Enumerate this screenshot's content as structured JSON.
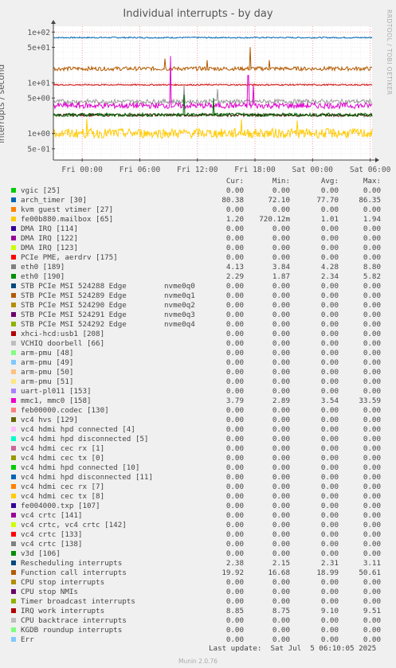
{
  "title": "Individual interrupts - by day",
  "watermark": "RRDTOOL / TOBI OETIKER",
  "munin_version": "Munin 2.0.76",
  "last_update": "Last update:  Sat Jul  5 06:10:05 2025",
  "columns": {
    "cur": "Cur:",
    "min": "Min:",
    "avg": "Avg:",
    "max": "Max:"
  },
  "chart_data": {
    "type": "line",
    "ylabel": "interrupts / second",
    "yscale": "log",
    "ylim": [
      0.3,
      130
    ],
    "y_ticks": [
      "1e+02",
      "5e+01",
      "1e+01",
      "5e+00",
      "1e+00",
      "5e-01"
    ],
    "y_tick_values": [
      100,
      50,
      10,
      5,
      1,
      0.5
    ],
    "x_ticks": [
      "Fri 00:00",
      "Fri 06:00",
      "Fri 12:00",
      "Fri 18:00",
      "Sat 00:00",
      "Sat 06:00"
    ],
    "x_tick_hours": [
      0,
      6,
      12,
      18,
      24,
      30
    ],
    "xlim_hours": [
      -3.0,
      30.2
    ],
    "grid": true,
    "series": [
      {
        "name": "arch_timer [30]",
        "color": "#0066B3",
        "base": 77.7,
        "noise": 0.03,
        "spikes": []
      },
      {
        "name": "Function call interrupts",
        "color": "#B35A00",
        "base": 19.0,
        "noise": 0.09,
        "spikes": [
          [
            8.6,
            30
          ],
          [
            13.0,
            28
          ],
          [
            17.5,
            50.6
          ],
          [
            19.5,
            28
          ]
        ]
      },
      {
        "name": "Rescheduling interrupts",
        "color": "#440000",
        "base": 2.31,
        "noise": 0.06,
        "spikes": []
      },
      {
        "name": "IRQ work interrupts",
        "color": "#CC0000",
        "base": 9.1,
        "noise": 0.03,
        "spikes": []
      },
      {
        "name": "eth0 [189]",
        "color": "#999999",
        "base": 4.28,
        "noise": 0.1,
        "spikes": [
          [
            10.6,
            8.8
          ],
          [
            14.1,
            7.5
          ]
        ]
      },
      {
        "name": "mmc1, mmc0 [158]",
        "color": "#DD00CC",
        "base": 3.54,
        "noise": 0.13,
        "spikes": [
          [
            9.2,
            33.59
          ],
          [
            17.3,
            14.0
          ],
          [
            17.8,
            9.0
          ]
        ]
      },
      {
        "name": "eth0 [190]",
        "color": "#006600",
        "base": 2.34,
        "noise": 0.08,
        "spikes": [
          [
            10.6,
            5.82
          ],
          [
            13.7,
            5.0
          ]
        ]
      },
      {
        "name": "fe00b880.mailbox [65]",
        "color": "#FFCC00",
        "base": 1.01,
        "noise": 0.22,
        "spikes": [
          [
            0.5,
            1.94
          ],
          [
            16.6,
            1.9
          ],
          [
            22.4,
            1.8
          ]
        ]
      }
    ],
    "legend": [
      {
        "name": "vgic [25]",
        "color": "#00CC00",
        "cur": "0.00",
        "min": "0.00",
        "avg": "0.00",
        "max": "0.00"
      },
      {
        "name": "arch_timer [30]",
        "color": "#0066B3",
        "cur": "80.38",
        "min": "72.10",
        "avg": "77.70",
        "max": "86.35"
      },
      {
        "name": "kvm guest vtimer [27]",
        "color": "#FF8000",
        "cur": "0.00",
        "min": "0.00",
        "avg": "0.00",
        "max": "0.00"
      },
      {
        "name": "fe00b880.mailbox [65]",
        "color": "#FFCC00",
        "cur": "1.20",
        "min": "720.12m",
        "avg": "1.01",
        "max": "1.94"
      },
      {
        "name": "DMA IRQ [114]",
        "color": "#330099",
        "cur": "0.00",
        "min": "0.00",
        "avg": "0.00",
        "max": "0.00"
      },
      {
        "name": "DMA IRQ [122]",
        "color": "#990099",
        "cur": "0.00",
        "min": "0.00",
        "avg": "0.00",
        "max": "0.00"
      },
      {
        "name": "DMA IRQ [123]",
        "color": "#CCFF00",
        "cur": "0.00",
        "min": "0.00",
        "avg": "0.00",
        "max": "0.00"
      },
      {
        "name": "PCIe PME, aerdrv [175]",
        "color": "#FF0000",
        "cur": "0.00",
        "min": "0.00",
        "avg": "0.00",
        "max": "0.00"
      },
      {
        "name": "eth0 [189]",
        "color": "#808080",
        "cur": "4.13",
        "min": "3.84",
        "avg": "4.28",
        "max": "8.80"
      },
      {
        "name": "eth0 [190]",
        "color": "#008F00",
        "cur": "2.29",
        "min": "1.87",
        "avg": "2.34",
        "max": "5.82"
      },
      {
        "name": "STB PCIe MSI 524288 Edge",
        "dev": "nvme0q0",
        "color": "#00487D",
        "cur": "0.00",
        "min": "0.00",
        "avg": "0.00",
        "max": "0.00"
      },
      {
        "name": "STB PCIe MSI 524289 Edge",
        "dev": "nvme0q1",
        "color": "#B35A00",
        "cur": "0.00",
        "min": "0.00",
        "avg": "0.00",
        "max": "0.00"
      },
      {
        "name": "STB PCIe MSI 524290 Edge",
        "dev": "nvme0q2",
        "color": "#B38F00",
        "cur": "0.00",
        "min": "0.00",
        "avg": "0.00",
        "max": "0.00"
      },
      {
        "name": "STB PCIe MSI 524291 Edge",
        "dev": "nvme0q3",
        "color": "#6B006B",
        "cur": "0.00",
        "min": "0.00",
        "avg": "0.00",
        "max": "0.00"
      },
      {
        "name": "STB PCIe MSI 524292 Edge",
        "dev": "nvme0q4",
        "color": "#8FB300",
        "cur": "0.00",
        "min": "0.00",
        "avg": "0.00",
        "max": "0.00"
      },
      {
        "name": "xhci-hcd:usb1 [208]",
        "color": "#B30000",
        "cur": "0.00",
        "min": "0.00",
        "avg": "0.00",
        "max": "0.00"
      },
      {
        "name": "VCHIQ doorbell [66]",
        "color": "#BEBEBE",
        "cur": "0.00",
        "min": "0.00",
        "avg": "0.00",
        "max": "0.00"
      },
      {
        "name": "arm-pmu [48]",
        "color": "#80FF80",
        "cur": "0.00",
        "min": "0.00",
        "avg": "0.00",
        "max": "0.00"
      },
      {
        "name": "arm-pmu [49]",
        "color": "#80C9FF",
        "cur": "0.00",
        "min": "0.00",
        "avg": "0.00",
        "max": "0.00"
      },
      {
        "name": "arm-pmu [50]",
        "color": "#FFC080",
        "cur": "0.00",
        "min": "0.00",
        "avg": "0.00",
        "max": "0.00"
      },
      {
        "name": "arm-pmu [51]",
        "color": "#FFE680",
        "cur": "0.00",
        "min": "0.00",
        "avg": "0.00",
        "max": "0.00"
      },
      {
        "name": "uart-pl011 [153]",
        "color": "#AA80FF",
        "cur": "0.00",
        "min": "0.00",
        "avg": "0.00",
        "max": "0.00"
      },
      {
        "name": "mmc1, mmc0 [158]",
        "color": "#EE00CC",
        "cur": "3.79",
        "min": "2.89",
        "avg": "3.54",
        "max": "33.59"
      },
      {
        "name": "feb00000.codec [130]",
        "color": "#FF8080",
        "cur": "0.00",
        "min": "0.00",
        "avg": "0.00",
        "max": "0.00"
      },
      {
        "name": "vc4 hvs [129]",
        "color": "#666600",
        "cur": "0.00",
        "min": "0.00",
        "avg": "0.00",
        "max": "0.00"
      },
      {
        "name": "vc4 hdmi hpd connected [4]",
        "color": "#FFBFFF",
        "cur": "0.00",
        "min": "0.00",
        "avg": "0.00",
        "max": "0.00"
      },
      {
        "name": "vc4 hdmi hpd disconnected [5]",
        "color": "#00FFCC",
        "cur": "0.00",
        "min": "0.00",
        "avg": "0.00",
        "max": "0.00"
      },
      {
        "name": "vc4 hdmi cec rx [1]",
        "color": "#CC6699",
        "cur": "0.00",
        "min": "0.00",
        "avg": "0.00",
        "max": "0.00"
      },
      {
        "name": "vc4 hdmi cec tx [0]",
        "color": "#999900",
        "cur": "0.00",
        "min": "0.00",
        "avg": "0.00",
        "max": "0.00"
      },
      {
        "name": "vc4 hdmi hpd connected [10]",
        "color": "#00CC00",
        "cur": "0.00",
        "min": "0.00",
        "avg": "0.00",
        "max": "0.00"
      },
      {
        "name": "vc4 hdmi hpd disconnected [11]",
        "color": "#0066B3",
        "cur": "0.00",
        "min": "0.00",
        "avg": "0.00",
        "max": "0.00"
      },
      {
        "name": "vc4 hdmi cec rx [7]",
        "color": "#FF8000",
        "cur": "0.00",
        "min": "0.00",
        "avg": "0.00",
        "max": "0.00"
      },
      {
        "name": "vc4 hdmi cec tx [8]",
        "color": "#FFCC00",
        "cur": "0.00",
        "min": "0.00",
        "avg": "0.00",
        "max": "0.00"
      },
      {
        "name": "fe004000.txp [107]",
        "color": "#330099",
        "cur": "0.00",
        "min": "0.00",
        "avg": "0.00",
        "max": "0.00"
      },
      {
        "name": "vc4 crtc [141]",
        "color": "#990099",
        "cur": "0.00",
        "min": "0.00",
        "avg": "0.00",
        "max": "0.00"
      },
      {
        "name": "vc4 crtc, vc4 crtc [142]",
        "color": "#CCFF00",
        "cur": "0.00",
        "min": "0.00",
        "avg": "0.00",
        "max": "0.00"
      },
      {
        "name": "vc4 crtc [133]",
        "color": "#FF0000",
        "cur": "0.00",
        "min": "0.00",
        "avg": "0.00",
        "max": "0.00"
      },
      {
        "name": "vc4 crtc [138]",
        "color": "#808080",
        "cur": "0.00",
        "min": "0.00",
        "avg": "0.00",
        "max": "0.00"
      },
      {
        "name": "v3d [106]",
        "color": "#008F00",
        "cur": "0.00",
        "min": "0.00",
        "avg": "0.00",
        "max": "0.00"
      },
      {
        "name": "Rescheduling interrupts",
        "color": "#00487D",
        "cur": "2.38",
        "min": "2.15",
        "avg": "2.31",
        "max": "3.11"
      },
      {
        "name": "Function call interrupts",
        "color": "#B35A00",
        "cur": "19.92",
        "min": "16.68",
        "avg": "18.99",
        "max": "50.61"
      },
      {
        "name": "CPU stop interrupts",
        "color": "#B38F00",
        "cur": "0.00",
        "min": "0.00",
        "avg": "0.00",
        "max": "0.00"
      },
      {
        "name": "CPU stop NMIs",
        "color": "#6B006B",
        "cur": "0.00",
        "min": "0.00",
        "avg": "0.00",
        "max": "0.00"
      },
      {
        "name": "Timer broadcast interrupts",
        "color": "#8FB300",
        "cur": "0.00",
        "min": "0.00",
        "avg": "0.00",
        "max": "0.00"
      },
      {
        "name": "IRQ work interrupts",
        "color": "#B30000",
        "cur": "8.85",
        "min": "8.75",
        "avg": "9.10",
        "max": "9.51"
      },
      {
        "name": "CPU backtrace interrupts",
        "color": "#BEBEBE",
        "cur": "0.00",
        "min": "0.00",
        "avg": "0.00",
        "max": "0.00"
      },
      {
        "name": "KGDB roundup interrupts",
        "color": "#80FF80",
        "cur": "0.00",
        "min": "0.00",
        "avg": "0.00",
        "max": "0.00"
      },
      {
        "name": "Err",
        "color": "#80C9FF",
        "cur": "0.00",
        "min": "0.00",
        "avg": "0.00",
        "max": "0.00"
      }
    ]
  }
}
